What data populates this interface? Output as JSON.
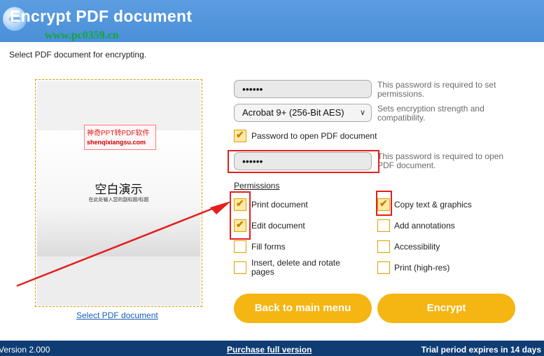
{
  "window": {
    "title": "Encrypt PDF document"
  },
  "watermark": {
    "url": "www.pc0359.cn",
    "stamp_line1": "神奇PPT转PDF软件",
    "stamp_line2": "shenqixiangsu.com"
  },
  "instruction": "Select PDF document for encrypting.",
  "preview": {
    "slide_title": "空白演示",
    "slide_subtitle": "在此处输入您的副标题/标题",
    "select_link": "Select PDF document"
  },
  "form": {
    "permissions_password": "••••••",
    "permissions_password_hint": [
      "This password is required to set",
      "permissions."
    ],
    "encryption": {
      "selected": "Acrobat 9+ (256-Bit AES)"
    },
    "encryption_hint": [
      "Sets encryption strength and",
      "compatibility."
    ],
    "open_password_checkbox": {
      "label": "Password to open PDF document",
      "checked": true
    },
    "open_password": "••••••",
    "open_password_hint": [
      "This password is required to open",
      "PDF document."
    ]
  },
  "permissions": {
    "heading": "Permissions",
    "left": [
      {
        "label": "Print document",
        "checked": true
      },
      {
        "label": "Edit document",
        "checked": true
      },
      {
        "label": "Fill forms",
        "checked": false
      },
      {
        "label": "Insert, delete and rotate",
        "label2": "pages",
        "checked": false
      }
    ],
    "right": [
      {
        "label": "Copy text & graphics",
        "checked": true
      },
      {
        "label": "Add annotations",
        "checked": false
      },
      {
        "label": "Accessibility",
        "checked": false
      },
      {
        "label": "Print (high-res)",
        "checked": false
      }
    ]
  },
  "buttons": {
    "back": "Back to main menu",
    "encrypt": "Encrypt"
  },
  "status": {
    "version": "Version 2.000",
    "purchase": "Purchase full version",
    "trial": "Trial period expires in 14 days"
  },
  "colors": {
    "header": "#4a8fd8",
    "accent": "#f5b512",
    "statusbar": "#0f3d73",
    "annotation": "#e51e1e"
  }
}
